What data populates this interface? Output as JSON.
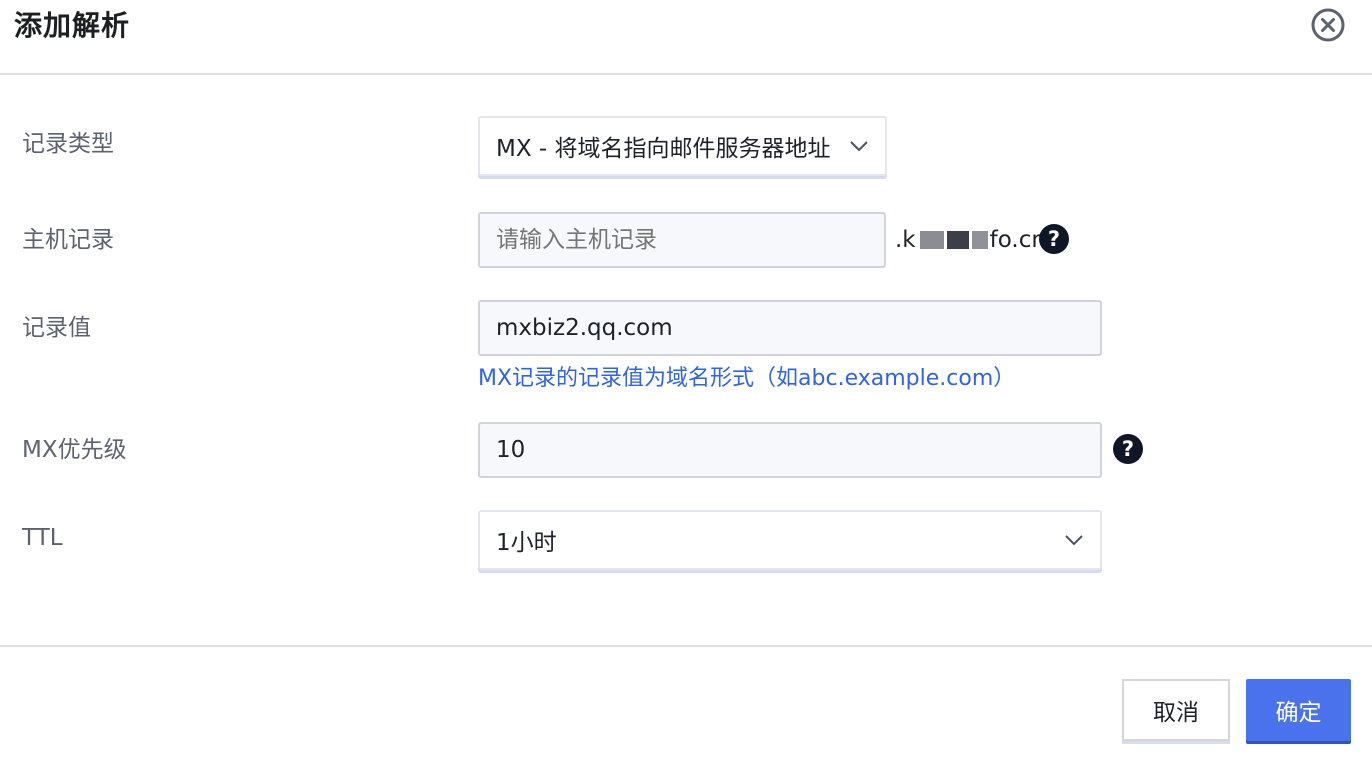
{
  "dialog": {
    "title": "添加解析",
    "close_icon": "close-circle-icon"
  },
  "form": {
    "record_type": {
      "label": "记录类型",
      "value": "MX - 将域名指向邮件服务器地址"
    },
    "host": {
      "label": "主机记录",
      "placeholder": "请输入主机记录",
      "value": "",
      "domain_prefix": ".k",
      "domain_suffix": "fo.cn"
    },
    "record_value": {
      "label": "记录值",
      "value": "mxbiz2.qq.com",
      "hint": "MX记录的记录值为域名形式（如abc.example.com）"
    },
    "mx_priority": {
      "label": "MX优先级",
      "value": "10"
    },
    "ttl": {
      "label": "TTL",
      "value": "1小时"
    },
    "help_icon_text": "?"
  },
  "footer": {
    "cancel_label": "取消",
    "confirm_label": "确定"
  },
  "colors": {
    "primary": "#4a72ec",
    "hint": "#2f63e8",
    "label": "#5b6270"
  }
}
